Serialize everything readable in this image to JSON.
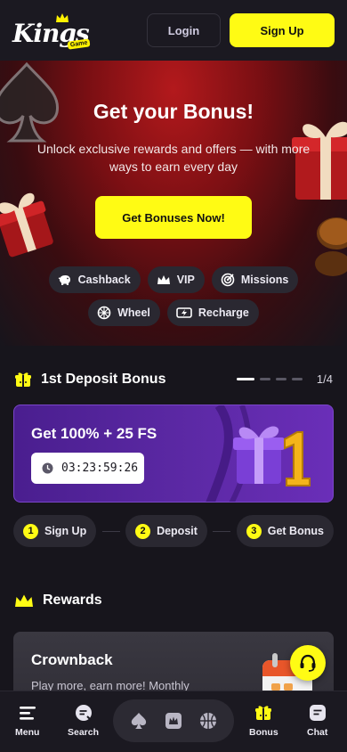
{
  "header": {
    "logo_text": "Kings",
    "logo_sub": "Game",
    "login_label": "Login",
    "signup_label": "Sign Up"
  },
  "hero": {
    "title": "Get your Bonus!",
    "subtitle": "Unlock exclusive rewards and offers — with more ways to earn every day",
    "cta_label": "Get Bonuses Now!"
  },
  "chips_row1": [
    {
      "label": "Cashback",
      "icon": "piggy-bank-icon"
    },
    {
      "label": "VIP",
      "icon": "crown-icon"
    },
    {
      "label": "Missions",
      "icon": "target-icon"
    }
  ],
  "chips_row2": [
    {
      "label": "Wheel",
      "icon": "wheel-icon"
    },
    {
      "label": "Recharge",
      "icon": "lightning-icon"
    }
  ],
  "deposit_section": {
    "title": "1st Deposit Bonus",
    "pager_count": "1/4",
    "pager_total": 4,
    "pager_active": 1
  },
  "deposit_card": {
    "title": "Get 100% + 25 FS",
    "timer": "03:23:59:26",
    "badge_number": "1"
  },
  "steps": [
    {
      "num": "1",
      "label": "Sign Up"
    },
    {
      "num": "2",
      "label": "Deposit"
    },
    {
      "num": "3",
      "label": "Get Bonus"
    }
  ],
  "rewards_section": {
    "title": "Rewards"
  },
  "crownback_card": {
    "title": "Crownback",
    "subtitle": "Play more, earn more! Monthly"
  },
  "bottom_nav": {
    "menu_label": "Menu",
    "search_label": "Search",
    "bonus_label": "Bonus",
    "chat_label": "Chat"
  },
  "colors": {
    "accent_yellow": "#fffb14",
    "background": "#17151c",
    "header_bg": "#1b1921",
    "chip_bg": "#2a2831",
    "card_purple": "#5c29a5"
  }
}
